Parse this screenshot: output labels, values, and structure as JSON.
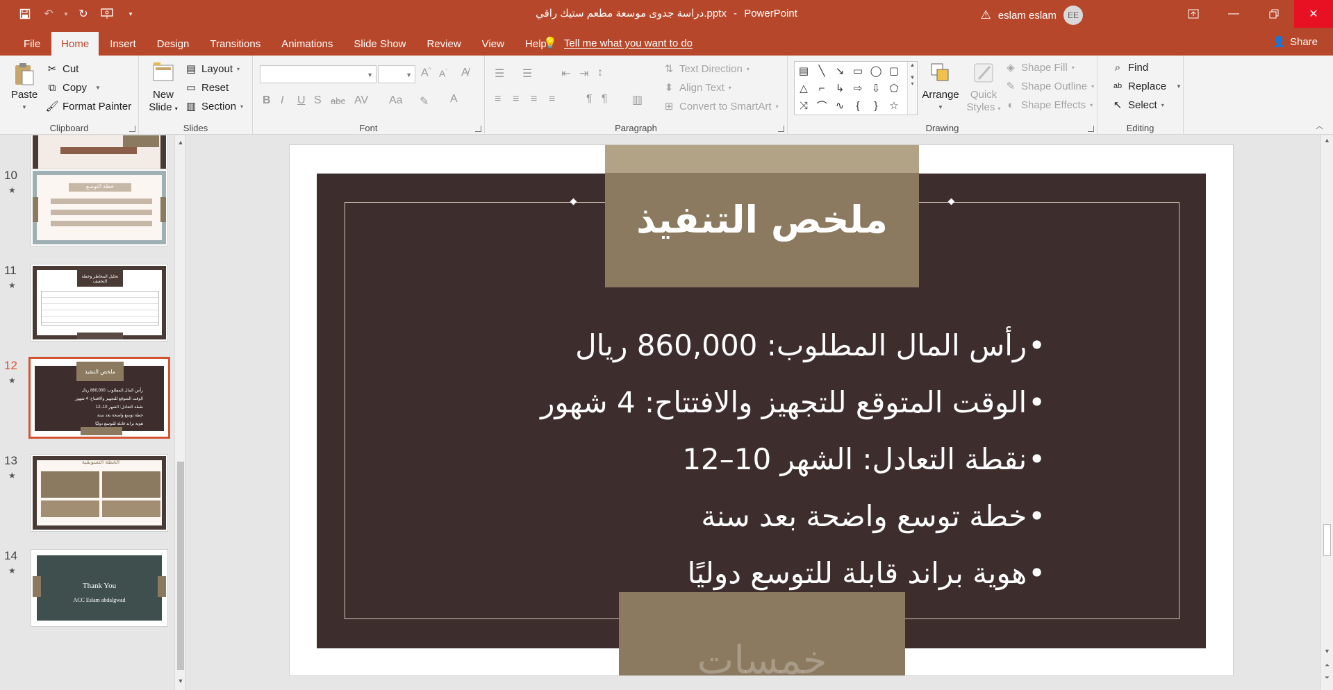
{
  "window": {
    "title": "دراسة جدوى موسعة مطعم ستيك راقي.pptx",
    "separator": "-",
    "app": "PowerPoint",
    "user_name": "eslam eslam",
    "user_initials": "EE"
  },
  "menu": {
    "tabs": [
      "File",
      "Home",
      "Insert",
      "Design",
      "Transitions",
      "Animations",
      "Slide Show",
      "Review",
      "View",
      "Help"
    ],
    "active": "Home",
    "tell_me": "Tell me what you want to do",
    "share": "Share"
  },
  "ribbon": {
    "clipboard": {
      "paste": "Paste",
      "cut": "Cut",
      "copy": "Copy",
      "format_painter": "Format Painter",
      "label": "Clipboard"
    },
    "slides": {
      "new_slide_line1": "New",
      "new_slide_line2": "Slide",
      "layout": "Layout",
      "reset": "Reset",
      "section": "Section",
      "label": "Slides"
    },
    "font": {
      "label": "Font"
    },
    "paragraph": {
      "text_direction": "Text Direction",
      "align_text": "Align Text",
      "convert_smartart": "Convert to SmartArt",
      "label": "Paragraph"
    },
    "drawing": {
      "arrange": "Arrange",
      "quick_styles_line1": "Quick",
      "quick_styles_line2": "Styles",
      "shape_fill": "Shape Fill",
      "shape_outline": "Shape Outline",
      "shape_effects": "Shape Effects",
      "label": "Drawing"
    },
    "editing": {
      "find": "Find",
      "replace": "Replace",
      "select": "Select",
      "label": "Editing"
    }
  },
  "thumbnails": [
    {
      "num": "10",
      "title": "خطة التوسع"
    },
    {
      "num": "11",
      "title": "تحليل المخاطر وخطة التخفيف"
    },
    {
      "num": "12",
      "title": "ملخص التنفيذ"
    },
    {
      "num": "13",
      "title": "الخطة التسويقية"
    },
    {
      "num": "14",
      "title": "Thank You",
      "subtitle": "ACC Eslam abdalgwad"
    }
  ],
  "selected_thumbnail": "12",
  "slide": {
    "title": "ملخص التنفيذ",
    "bullets": [
      "رأس المال المطلوب: 860,000 ريال",
      "الوقت المتوقع للتجهيز والافتتاح: 4 شهور",
      "نقطة التعادل: الشهر 10–12",
      "خطة توسع واضحة بعد سنة",
      "هوية براند قابلة للتوسع دوليًا"
    ],
    "watermark": "خمسات"
  },
  "colors": {
    "accent": "#b7472a",
    "slide_panel": "#3e2d2d",
    "slide_gold": "#8b7a5f",
    "slide_gold_light": "#b2a286",
    "selection": "#d35230"
  }
}
